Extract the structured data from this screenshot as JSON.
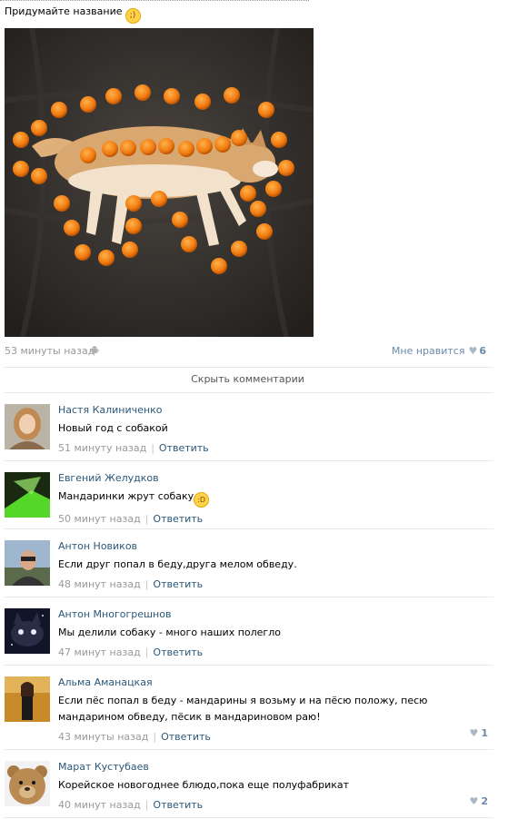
{
  "post": {
    "caption": "Придумайте название",
    "time": "53 минуты назад",
    "like_label": "Мне нравится",
    "like_count": "6"
  },
  "hide_comments_label": "Скрыть комментарии",
  "comments": [
    {
      "author": "Настя Калиниченко",
      "text": "Новый год с собакой",
      "time": "51 минуту назад",
      "reply": "Ответить",
      "likes": ""
    },
    {
      "author": "Евгений Желудков",
      "text": "Мандаринки жрут собаку",
      "time": "50 минут назад",
      "reply": "Ответить",
      "likes": ""
    },
    {
      "author": "Антон Новиков",
      "text": "Если друг попал в беду,друга мелом обведу.",
      "time": "48 минут назад",
      "reply": "Ответить",
      "likes": ""
    },
    {
      "author": "Антон Многогрешнов",
      "text": "Мы делили собаку - много наших полегло",
      "time": "47 минут назад",
      "reply": "Ответить",
      "likes": ""
    },
    {
      "author": "Альма Аманацкая",
      "text": "Если пёс попал в беду - мандарины я возьму и на пёсю положу, песю мандарином обведу, пёсик в мандариновом раю!",
      "time": "43 минуты назад",
      "reply": "Ответить",
      "likes": "1"
    },
    {
      "author": "Марат Кустубаев",
      "text": "Корейское новогоднее блюдо,пока еще полуфабрикат",
      "time": "40 минут назад",
      "reply": "Ответить",
      "likes": "2"
    }
  ],
  "icons": {
    "wink": "wink-emoji-icon",
    "grin": "grin-emoji-icon",
    "android": "android-icon",
    "heart": "heart-icon"
  },
  "colors": {
    "link": "#2b587a",
    "meta": "#999999",
    "separator": "#e5e8ec"
  }
}
